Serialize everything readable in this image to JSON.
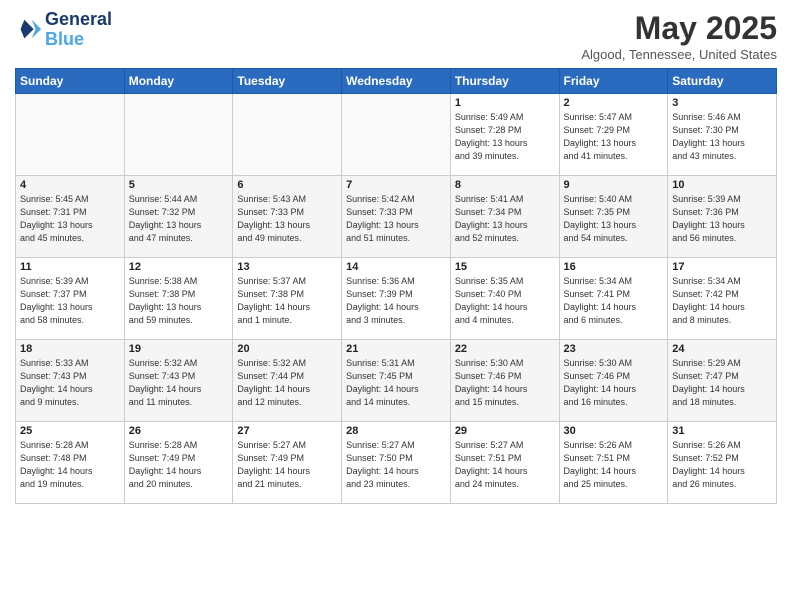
{
  "header": {
    "logo_line1": "General",
    "logo_line2": "Blue",
    "month_title": "May 2025",
    "location": "Algood, Tennessee, United States"
  },
  "weekdays": [
    "Sunday",
    "Monday",
    "Tuesday",
    "Wednesday",
    "Thursday",
    "Friday",
    "Saturday"
  ],
  "weeks": [
    {
      "days": [
        {
          "num": "",
          "info": ""
        },
        {
          "num": "",
          "info": ""
        },
        {
          "num": "",
          "info": ""
        },
        {
          "num": "",
          "info": ""
        },
        {
          "num": "1",
          "info": "Sunrise: 5:49 AM\nSunset: 7:28 PM\nDaylight: 13 hours\nand 39 minutes."
        },
        {
          "num": "2",
          "info": "Sunrise: 5:47 AM\nSunset: 7:29 PM\nDaylight: 13 hours\nand 41 minutes."
        },
        {
          "num": "3",
          "info": "Sunrise: 5:46 AM\nSunset: 7:30 PM\nDaylight: 13 hours\nand 43 minutes."
        }
      ]
    },
    {
      "days": [
        {
          "num": "4",
          "info": "Sunrise: 5:45 AM\nSunset: 7:31 PM\nDaylight: 13 hours\nand 45 minutes."
        },
        {
          "num": "5",
          "info": "Sunrise: 5:44 AM\nSunset: 7:32 PM\nDaylight: 13 hours\nand 47 minutes."
        },
        {
          "num": "6",
          "info": "Sunrise: 5:43 AM\nSunset: 7:33 PM\nDaylight: 13 hours\nand 49 minutes."
        },
        {
          "num": "7",
          "info": "Sunrise: 5:42 AM\nSunset: 7:33 PM\nDaylight: 13 hours\nand 51 minutes."
        },
        {
          "num": "8",
          "info": "Sunrise: 5:41 AM\nSunset: 7:34 PM\nDaylight: 13 hours\nand 52 minutes."
        },
        {
          "num": "9",
          "info": "Sunrise: 5:40 AM\nSunset: 7:35 PM\nDaylight: 13 hours\nand 54 minutes."
        },
        {
          "num": "10",
          "info": "Sunrise: 5:39 AM\nSunset: 7:36 PM\nDaylight: 13 hours\nand 56 minutes."
        }
      ]
    },
    {
      "days": [
        {
          "num": "11",
          "info": "Sunrise: 5:39 AM\nSunset: 7:37 PM\nDaylight: 13 hours\nand 58 minutes."
        },
        {
          "num": "12",
          "info": "Sunrise: 5:38 AM\nSunset: 7:38 PM\nDaylight: 13 hours\nand 59 minutes."
        },
        {
          "num": "13",
          "info": "Sunrise: 5:37 AM\nSunset: 7:38 PM\nDaylight: 14 hours\nand 1 minute."
        },
        {
          "num": "14",
          "info": "Sunrise: 5:36 AM\nSunset: 7:39 PM\nDaylight: 14 hours\nand 3 minutes."
        },
        {
          "num": "15",
          "info": "Sunrise: 5:35 AM\nSunset: 7:40 PM\nDaylight: 14 hours\nand 4 minutes."
        },
        {
          "num": "16",
          "info": "Sunrise: 5:34 AM\nSunset: 7:41 PM\nDaylight: 14 hours\nand 6 minutes."
        },
        {
          "num": "17",
          "info": "Sunrise: 5:34 AM\nSunset: 7:42 PM\nDaylight: 14 hours\nand 8 minutes."
        }
      ]
    },
    {
      "days": [
        {
          "num": "18",
          "info": "Sunrise: 5:33 AM\nSunset: 7:43 PM\nDaylight: 14 hours\nand 9 minutes."
        },
        {
          "num": "19",
          "info": "Sunrise: 5:32 AM\nSunset: 7:43 PM\nDaylight: 14 hours\nand 11 minutes."
        },
        {
          "num": "20",
          "info": "Sunrise: 5:32 AM\nSunset: 7:44 PM\nDaylight: 14 hours\nand 12 minutes."
        },
        {
          "num": "21",
          "info": "Sunrise: 5:31 AM\nSunset: 7:45 PM\nDaylight: 14 hours\nand 14 minutes."
        },
        {
          "num": "22",
          "info": "Sunrise: 5:30 AM\nSunset: 7:46 PM\nDaylight: 14 hours\nand 15 minutes."
        },
        {
          "num": "23",
          "info": "Sunrise: 5:30 AM\nSunset: 7:46 PM\nDaylight: 14 hours\nand 16 minutes."
        },
        {
          "num": "24",
          "info": "Sunrise: 5:29 AM\nSunset: 7:47 PM\nDaylight: 14 hours\nand 18 minutes."
        }
      ]
    },
    {
      "days": [
        {
          "num": "25",
          "info": "Sunrise: 5:28 AM\nSunset: 7:48 PM\nDaylight: 14 hours\nand 19 minutes."
        },
        {
          "num": "26",
          "info": "Sunrise: 5:28 AM\nSunset: 7:49 PM\nDaylight: 14 hours\nand 20 minutes."
        },
        {
          "num": "27",
          "info": "Sunrise: 5:27 AM\nSunset: 7:49 PM\nDaylight: 14 hours\nand 21 minutes."
        },
        {
          "num": "28",
          "info": "Sunrise: 5:27 AM\nSunset: 7:50 PM\nDaylight: 14 hours\nand 23 minutes."
        },
        {
          "num": "29",
          "info": "Sunrise: 5:27 AM\nSunset: 7:51 PM\nDaylight: 14 hours\nand 24 minutes."
        },
        {
          "num": "30",
          "info": "Sunrise: 5:26 AM\nSunset: 7:51 PM\nDaylight: 14 hours\nand 25 minutes."
        },
        {
          "num": "31",
          "info": "Sunrise: 5:26 AM\nSunset: 7:52 PM\nDaylight: 14 hours\nand 26 minutes."
        }
      ]
    }
  ]
}
